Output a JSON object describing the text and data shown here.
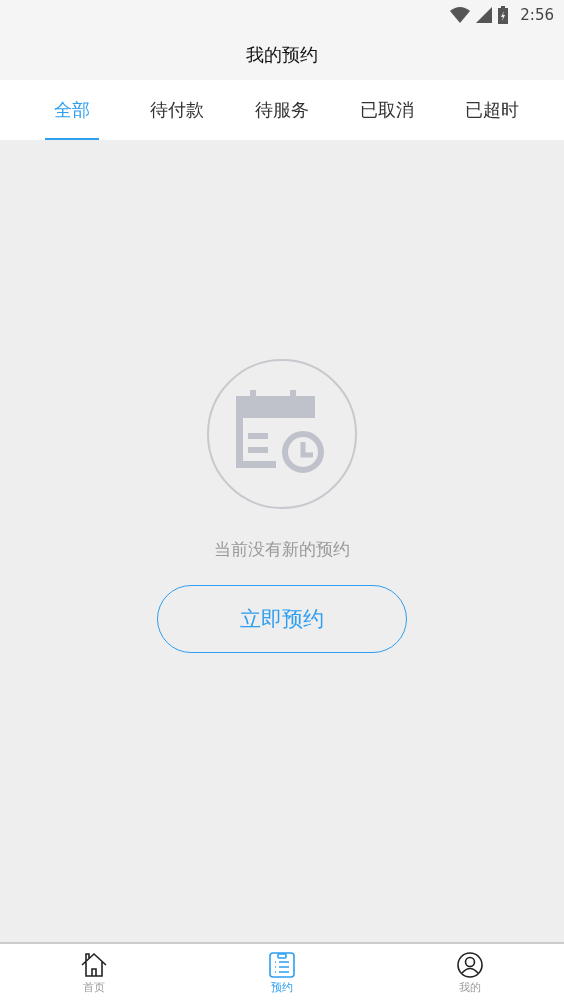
{
  "status_bar": {
    "time": "2:56"
  },
  "header": {
    "title": "我的预约"
  },
  "tabs": [
    {
      "label": "全部",
      "selected": true
    },
    {
      "label": "待付款",
      "selected": false
    },
    {
      "label": "待服务",
      "selected": false
    },
    {
      "label": "已取消",
      "selected": false
    },
    {
      "label": "已超时",
      "selected": false
    }
  ],
  "empty_state": {
    "message": "当前没有新的预约",
    "button": "立即预约"
  },
  "bottom_nav": [
    {
      "label": "首页",
      "kind": "home",
      "selected": false
    },
    {
      "label": "预约",
      "kind": "list",
      "selected": true
    },
    {
      "label": "我的",
      "kind": "user",
      "selected": false
    }
  ]
}
